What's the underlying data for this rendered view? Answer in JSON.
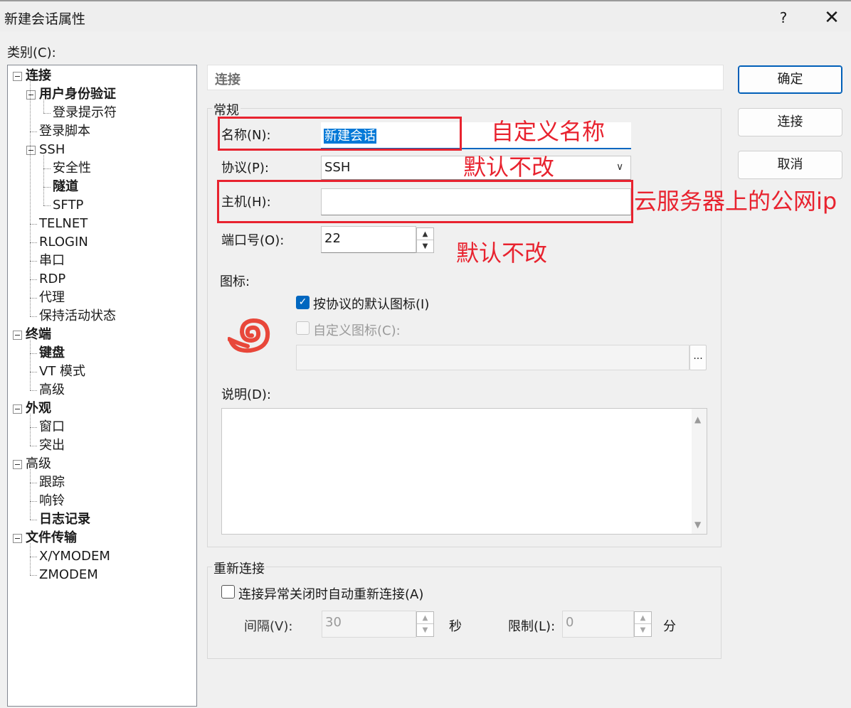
{
  "window": {
    "title": "新建会话属性",
    "help_label": "?",
    "close_label": "✕"
  },
  "category_label": "类别(C):",
  "tree": [
    {
      "label": "连接",
      "bold": true,
      "level": 0,
      "toggle": true
    },
    {
      "label": "用户身份验证",
      "bold": true,
      "level": 1,
      "toggle": true
    },
    {
      "label": "登录提示符",
      "bold": false,
      "level": 2,
      "toggle": false
    },
    {
      "label": "登录脚本",
      "bold": false,
      "level": 1,
      "toggle": false
    },
    {
      "label": "SSH",
      "bold": false,
      "level": 1,
      "toggle": true
    },
    {
      "label": "安全性",
      "bold": false,
      "level": 2,
      "toggle": false
    },
    {
      "label": "隧道",
      "bold": true,
      "level": 2,
      "toggle": false
    },
    {
      "label": "SFTP",
      "bold": false,
      "level": 2,
      "toggle": false
    },
    {
      "label": "TELNET",
      "bold": false,
      "level": 1,
      "toggle": false
    },
    {
      "label": "RLOGIN",
      "bold": false,
      "level": 1,
      "toggle": false
    },
    {
      "label": "串口",
      "bold": false,
      "level": 1,
      "toggle": false
    },
    {
      "label": "RDP",
      "bold": false,
      "level": 1,
      "toggle": false
    },
    {
      "label": "代理",
      "bold": false,
      "level": 1,
      "toggle": false
    },
    {
      "label": "保持活动状态",
      "bold": false,
      "level": 1,
      "toggle": false
    },
    {
      "label": "终端",
      "bold": true,
      "level": 0,
      "toggle": true
    },
    {
      "label": "键盘",
      "bold": true,
      "level": 1,
      "toggle": false
    },
    {
      "label": "VT 模式",
      "bold": false,
      "level": 1,
      "toggle": false
    },
    {
      "label": "高级",
      "bold": false,
      "level": 1,
      "toggle": false
    },
    {
      "label": "外观",
      "bold": true,
      "level": 0,
      "toggle": true
    },
    {
      "label": "窗口",
      "bold": false,
      "level": 1,
      "toggle": false
    },
    {
      "label": "突出",
      "bold": false,
      "level": 1,
      "toggle": false
    },
    {
      "label": "高级",
      "bold": false,
      "level": 0,
      "toggle": true
    },
    {
      "label": "跟踪",
      "bold": false,
      "level": 1,
      "toggle": false
    },
    {
      "label": "响铃",
      "bold": false,
      "level": 1,
      "toggle": false
    },
    {
      "label": "日志记录",
      "bold": true,
      "level": 1,
      "toggle": false
    },
    {
      "label": "文件传输",
      "bold": true,
      "level": 0,
      "toggle": true
    },
    {
      "label": "X/YMODEM",
      "bold": false,
      "level": 1,
      "toggle": false
    },
    {
      "label": "ZMODEM",
      "bold": false,
      "level": 1,
      "toggle": false
    }
  ],
  "section_title": "连接",
  "general": {
    "group_title": "常规",
    "name_label": "名称(N):",
    "name_value": "新建会话",
    "protocol_label": "协议(P):",
    "protocol_value": "SSH",
    "host_label": "主机(H):",
    "host_value": "",
    "port_label": "端口号(O):",
    "port_value": "22",
    "icon_label": "图标:",
    "default_icon_label": "按协议的默认图标(I)",
    "default_icon_checked": true,
    "custom_icon_label": "自定义图标(C):",
    "custom_icon_checked": false,
    "custom_icon_path": "",
    "browse_label": "...",
    "description_label": "说明(D):",
    "description_value": ""
  },
  "reconnect": {
    "group_title": "重新连接",
    "auto_reconnect_label": "连接异常关闭时自动重新连接(A)",
    "auto_reconnect_checked": false,
    "interval_label": "间隔(V):",
    "interval_value": "30",
    "interval_unit": "秒",
    "limit_label": "限制(L):",
    "limit_value": "0",
    "limit_unit": "分"
  },
  "buttons": {
    "ok": "确定",
    "connect": "连接",
    "cancel": "取消"
  },
  "annotations": {
    "name_note": "自定义名称",
    "protocol_note": "默认不改",
    "host_note": "云服务器上的公网ip",
    "port_note": "默认不改"
  },
  "colors": {
    "annotation": "#e8232f",
    "accent": "#0067c0",
    "icon": "#e8473a"
  }
}
